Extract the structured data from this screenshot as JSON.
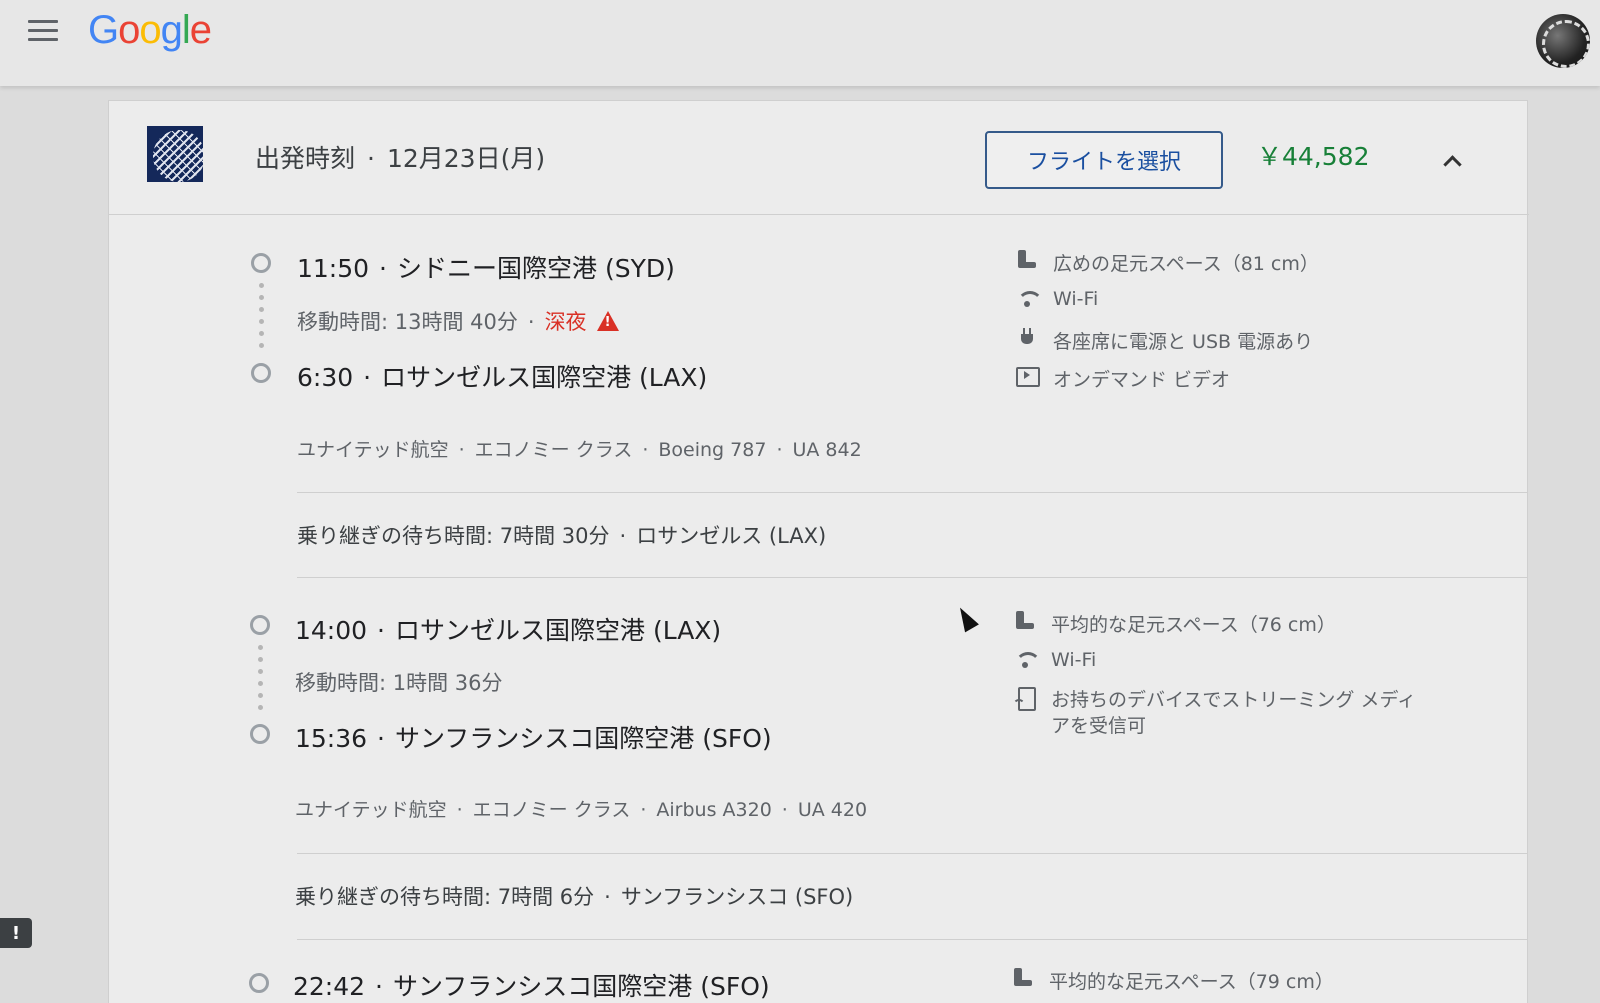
{
  "app": {
    "logo_letters": [
      {
        "ch": "G",
        "color": "#4285F4"
      },
      {
        "ch": "o",
        "color": "#EA4335"
      },
      {
        "ch": "o",
        "color": "#FBBC05"
      },
      {
        "ch": "g",
        "color": "#4285F4"
      },
      {
        "ch": "l",
        "color": "#34A853"
      },
      {
        "ch": "e",
        "color": "#EA4335"
      }
    ]
  },
  "header": {
    "departure_label": "出発時刻",
    "separator": "·",
    "date": "12月23日(月)",
    "select_button": "フライトを選択",
    "price": "￥44,582",
    "collapse_icon": "chevron-up-icon",
    "price_color": "#188038"
  },
  "segments": [
    {
      "depart": {
        "time": "11:50",
        "airport": "シドニー国際空港 (SYD)"
      },
      "duration": "移動時間: 13時間 40分",
      "overnight": "深夜",
      "arrive": {
        "time": "6:30",
        "airport": "ロサンゼルス国際空港 (LAX)"
      },
      "meta": {
        "airline": "ユナイテッド航空",
        "class": "エコノミー クラス",
        "aircraft": "Boeing 787",
        "flight": "UA 842"
      },
      "amenities": [
        {
          "icon": "legroom-icon",
          "text": "広めの足元スペース（81 cm）"
        },
        {
          "icon": "wifi-icon",
          "text": "Wi-Fi"
        },
        {
          "icon": "power-outlet-icon",
          "text": "各座席に電源と USB 電源あり"
        },
        {
          "icon": "on-demand-video-icon",
          "text": "オンデマンド ビデオ"
        }
      ]
    },
    {
      "depart": {
        "time": "14:00",
        "airport": "ロサンゼルス国際空港 (LAX)"
      },
      "duration": "移動時間: 1時間 36分",
      "arrive": {
        "time": "15:36",
        "airport": "サンフランシスコ国際空港 (SFO)"
      },
      "meta": {
        "airline": "ユナイテッド航空",
        "class": "エコノミー クラス",
        "aircraft": "Airbus A320",
        "flight": "UA 420"
      },
      "amenities": [
        {
          "icon": "legroom-icon",
          "text": "平均的な足元スペース（76 cm）"
        },
        {
          "icon": "wifi-icon",
          "text": "Wi-Fi"
        },
        {
          "icon": "stream-media-icon",
          "text_line1": "お持ちのデバイスでストリーミング メディ",
          "text_line2": "アを受信可"
        }
      ]
    }
  ],
  "layovers": [
    {
      "text": "乗り継ぎの待ち時間: 7時間 30分",
      "place": "ロサンゼルス (LAX)"
    },
    {
      "text": "乗り継ぎの待ち時間: 7時間 6分",
      "place": "サンフランシスコ (SFO)"
    }
  ],
  "next_segment_partial": {
    "depart_time": "22:42",
    "airport": "サンフランシスコ国際空港 (SFO)",
    "amenity": "平均的な足元スペース（79 cm）"
  },
  "colors": {
    "warning": "#d93025",
    "button_border": "#355a8a"
  }
}
